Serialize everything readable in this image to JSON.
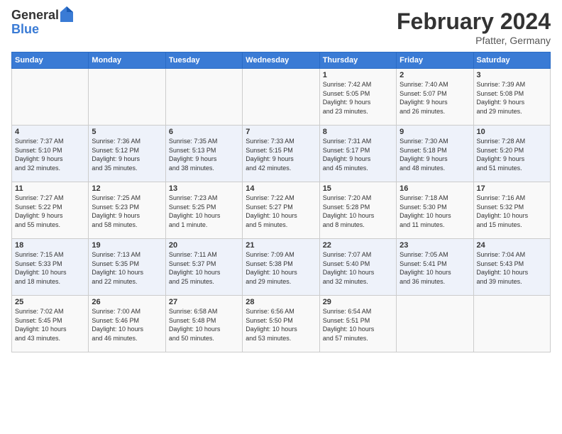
{
  "header": {
    "logo_general": "General",
    "logo_blue": "Blue",
    "month_title": "February 2024",
    "subtitle": "Pfatter, Germany"
  },
  "days_of_week": [
    "Sunday",
    "Monday",
    "Tuesday",
    "Wednesday",
    "Thursday",
    "Friday",
    "Saturday"
  ],
  "weeks": [
    [
      {
        "day": "",
        "info": ""
      },
      {
        "day": "",
        "info": ""
      },
      {
        "day": "",
        "info": ""
      },
      {
        "day": "",
        "info": ""
      },
      {
        "day": "1",
        "info": "Sunrise: 7:42 AM\nSunset: 5:05 PM\nDaylight: 9 hours\nand 23 minutes."
      },
      {
        "day": "2",
        "info": "Sunrise: 7:40 AM\nSunset: 5:07 PM\nDaylight: 9 hours\nand 26 minutes."
      },
      {
        "day": "3",
        "info": "Sunrise: 7:39 AM\nSunset: 5:08 PM\nDaylight: 9 hours\nand 29 minutes."
      }
    ],
    [
      {
        "day": "4",
        "info": "Sunrise: 7:37 AM\nSunset: 5:10 PM\nDaylight: 9 hours\nand 32 minutes."
      },
      {
        "day": "5",
        "info": "Sunrise: 7:36 AM\nSunset: 5:12 PM\nDaylight: 9 hours\nand 35 minutes."
      },
      {
        "day": "6",
        "info": "Sunrise: 7:35 AM\nSunset: 5:13 PM\nDaylight: 9 hours\nand 38 minutes."
      },
      {
        "day": "7",
        "info": "Sunrise: 7:33 AM\nSunset: 5:15 PM\nDaylight: 9 hours\nand 42 minutes."
      },
      {
        "day": "8",
        "info": "Sunrise: 7:31 AM\nSunset: 5:17 PM\nDaylight: 9 hours\nand 45 minutes."
      },
      {
        "day": "9",
        "info": "Sunrise: 7:30 AM\nSunset: 5:18 PM\nDaylight: 9 hours\nand 48 minutes."
      },
      {
        "day": "10",
        "info": "Sunrise: 7:28 AM\nSunset: 5:20 PM\nDaylight: 9 hours\nand 51 minutes."
      }
    ],
    [
      {
        "day": "11",
        "info": "Sunrise: 7:27 AM\nSunset: 5:22 PM\nDaylight: 9 hours\nand 55 minutes."
      },
      {
        "day": "12",
        "info": "Sunrise: 7:25 AM\nSunset: 5:23 PM\nDaylight: 9 hours\nand 58 minutes."
      },
      {
        "day": "13",
        "info": "Sunrise: 7:23 AM\nSunset: 5:25 PM\nDaylight: 10 hours\nand 1 minute."
      },
      {
        "day": "14",
        "info": "Sunrise: 7:22 AM\nSunset: 5:27 PM\nDaylight: 10 hours\nand 5 minutes."
      },
      {
        "day": "15",
        "info": "Sunrise: 7:20 AM\nSunset: 5:28 PM\nDaylight: 10 hours\nand 8 minutes."
      },
      {
        "day": "16",
        "info": "Sunrise: 7:18 AM\nSunset: 5:30 PM\nDaylight: 10 hours\nand 11 minutes."
      },
      {
        "day": "17",
        "info": "Sunrise: 7:16 AM\nSunset: 5:32 PM\nDaylight: 10 hours\nand 15 minutes."
      }
    ],
    [
      {
        "day": "18",
        "info": "Sunrise: 7:15 AM\nSunset: 5:33 PM\nDaylight: 10 hours\nand 18 minutes."
      },
      {
        "day": "19",
        "info": "Sunrise: 7:13 AM\nSunset: 5:35 PM\nDaylight: 10 hours\nand 22 minutes."
      },
      {
        "day": "20",
        "info": "Sunrise: 7:11 AM\nSunset: 5:37 PM\nDaylight: 10 hours\nand 25 minutes."
      },
      {
        "day": "21",
        "info": "Sunrise: 7:09 AM\nSunset: 5:38 PM\nDaylight: 10 hours\nand 29 minutes."
      },
      {
        "day": "22",
        "info": "Sunrise: 7:07 AM\nSunset: 5:40 PM\nDaylight: 10 hours\nand 32 minutes."
      },
      {
        "day": "23",
        "info": "Sunrise: 7:05 AM\nSunset: 5:41 PM\nDaylight: 10 hours\nand 36 minutes."
      },
      {
        "day": "24",
        "info": "Sunrise: 7:04 AM\nSunset: 5:43 PM\nDaylight: 10 hours\nand 39 minutes."
      }
    ],
    [
      {
        "day": "25",
        "info": "Sunrise: 7:02 AM\nSunset: 5:45 PM\nDaylight: 10 hours\nand 43 minutes."
      },
      {
        "day": "26",
        "info": "Sunrise: 7:00 AM\nSunset: 5:46 PM\nDaylight: 10 hours\nand 46 minutes."
      },
      {
        "day": "27",
        "info": "Sunrise: 6:58 AM\nSunset: 5:48 PM\nDaylight: 10 hours\nand 50 minutes."
      },
      {
        "day": "28",
        "info": "Sunrise: 6:56 AM\nSunset: 5:50 PM\nDaylight: 10 hours\nand 53 minutes."
      },
      {
        "day": "29",
        "info": "Sunrise: 6:54 AM\nSunset: 5:51 PM\nDaylight: 10 hours\nand 57 minutes."
      },
      {
        "day": "",
        "info": ""
      },
      {
        "day": "",
        "info": ""
      }
    ]
  ]
}
